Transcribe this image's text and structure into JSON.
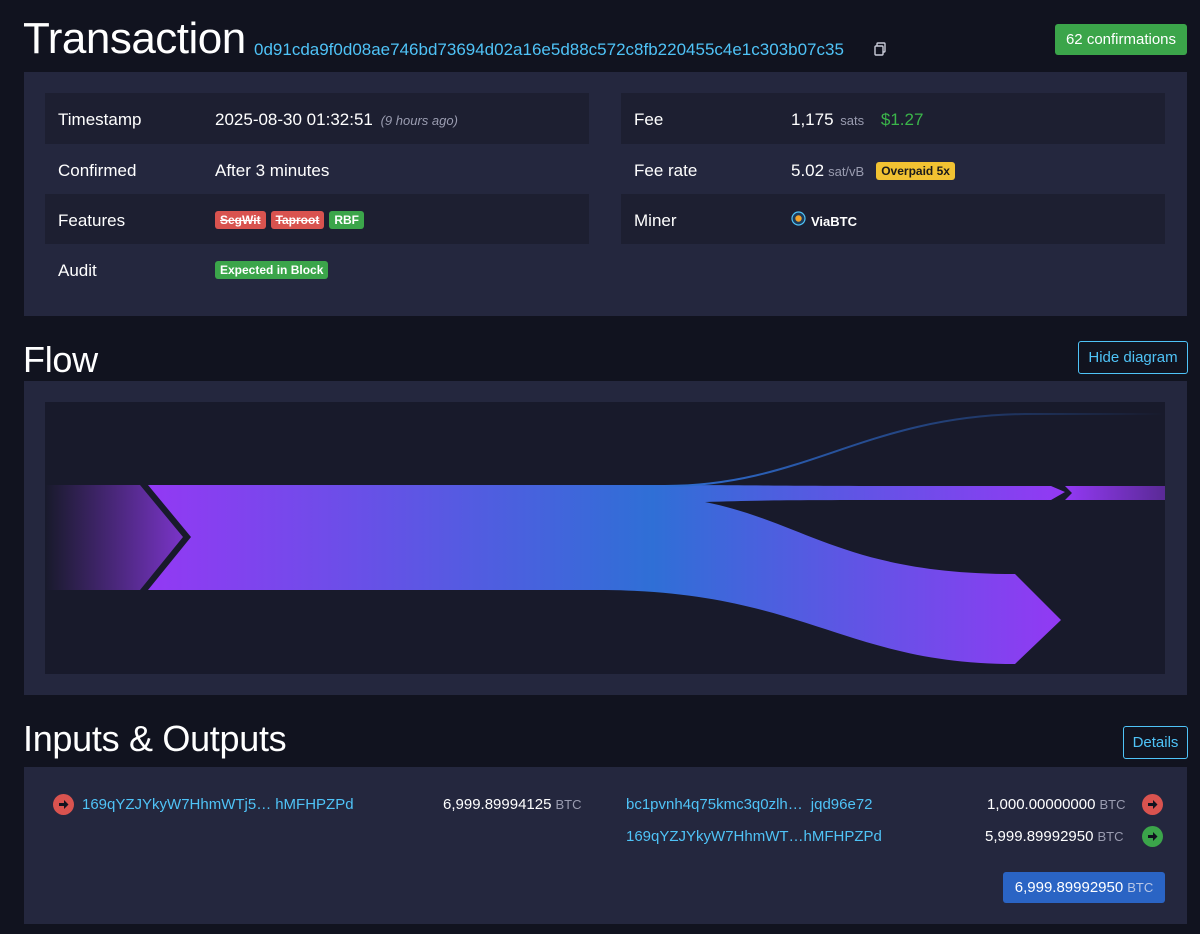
{
  "header": {
    "title": "Transaction",
    "txid": "0d91cda9f0d08ae746bd73694d02a16e5d88c572c8fb220455c4e1c303b07c35",
    "confirmations": "62 confirmations"
  },
  "details": {
    "timestamp_label": "Timestamp",
    "timestamp_value": "2025-08-30 01:32:51",
    "timestamp_ago": "(9 hours ago)",
    "confirmed_label": "Confirmed",
    "confirmed_value": "After 3 minutes",
    "features_label": "Features",
    "features": [
      "SegWit",
      "Taproot",
      "RBF"
    ],
    "audit_label": "Audit",
    "audit_badge": "Expected in Block",
    "fee_label": "Fee",
    "fee_value": "1,175",
    "fee_unit": "sats",
    "fee_usd": "$1.27",
    "feerate_label": "Fee rate",
    "feerate_value": "5.02",
    "feerate_unit": "sat/vB",
    "feerate_badge": "Overpaid 5x",
    "miner_label": "Miner",
    "miner_value": "ViaBTC"
  },
  "flow": {
    "title": "Flow",
    "hide_button": "Hide diagram"
  },
  "io": {
    "title": "Inputs & Outputs",
    "details_button": "Details",
    "unit": "BTC",
    "inputs": [
      {
        "address_start": "169qYZJYkyW7HhmWTj5…",
        "address_end": "hMFHPZPd",
        "amount": "6,999.89994125"
      }
    ],
    "outputs": [
      {
        "address_start": "bc1pvnh4q75kmc3q0zlh…",
        "address_end": "jqd96e72",
        "amount": "1,000.00000000"
      },
      {
        "address_start": "169qYZJYkyW7HhmWT…",
        "address_end": "hMFHPZPd",
        "amount": "5,999.89992950"
      }
    ],
    "total": "6,999.89992950"
  },
  "colors": {
    "accent": "#4fc3f7",
    "confirm_green": "#3ba54a",
    "flow_purple": "#9339f4",
    "flow_blue": "#2f6fd6",
    "total_blue": "#2a64c4"
  }
}
